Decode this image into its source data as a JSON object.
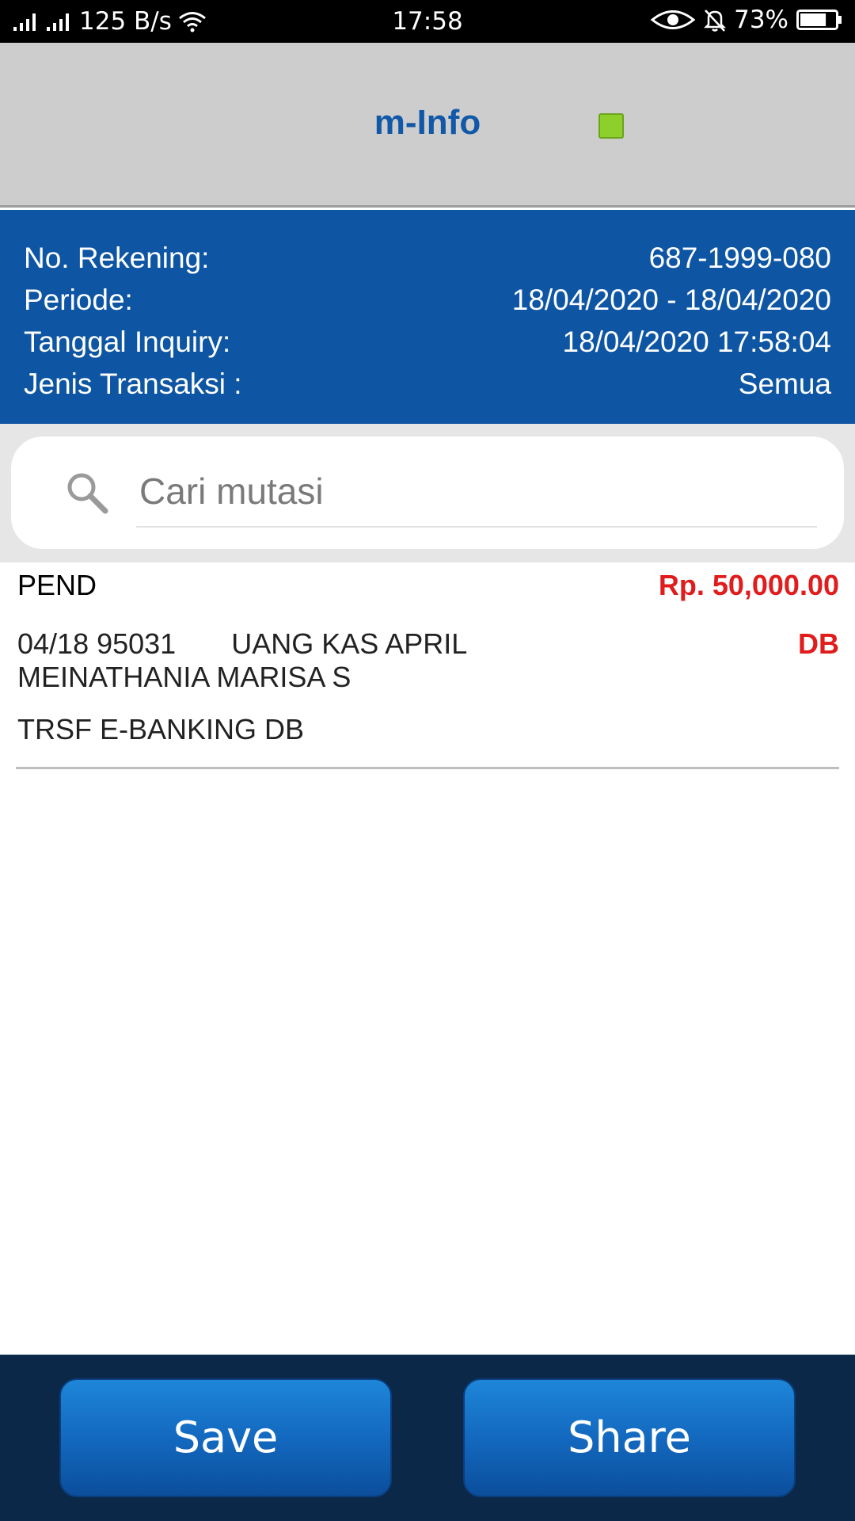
{
  "status_bar": {
    "network_speed": "125 B/s",
    "time": "17:58",
    "battery_percent": "73%",
    "battery_level": 0.73
  },
  "header": {
    "title": "m-Info",
    "indicator_color": "#8ed02b"
  },
  "account_info": {
    "rows": [
      {
        "label": "No. Rekening:",
        "value": "687-1999-080"
      },
      {
        "label": "Periode:",
        "value": "18/04/2020 - 18/04/2020"
      },
      {
        "label": "Tanggal Inquiry:",
        "value": "18/04/2020 17:58:04"
      },
      {
        "label": "Jenis Transaksi :",
        "value": "Semua"
      }
    ]
  },
  "search": {
    "placeholder": "Cari mutasi",
    "value": ""
  },
  "transactions": [
    {
      "date": "PEND",
      "amount": "Rp. 50,000.00",
      "reference": "04/18 95031",
      "memo": "UANG KAS APRIL",
      "type": "DB",
      "name": "MEINATHANIA MARISA S",
      "description": "TRSF E-BANKING DB"
    }
  ],
  "actions": {
    "save_label": "Save",
    "share_label": "Share"
  },
  "colors": {
    "header_bg": "#cdcdcd",
    "title": "#1159a8",
    "panel_bg": "#0e56a4",
    "debit": "#e01c1c",
    "bottom_bar": "#0b2849"
  }
}
